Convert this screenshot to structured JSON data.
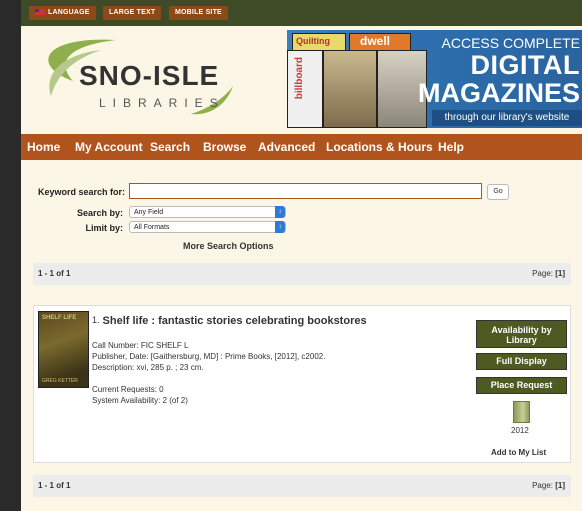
{
  "utility_bar": {
    "language": "LANGUAGE",
    "large_text": "LARGE TEXT",
    "mobile_site": "MOBILE SITE"
  },
  "logo": {
    "name": "SNO-ISLE",
    "sub": "LIBRARIES"
  },
  "banner": {
    "line1": "ACCESS COMPLETE",
    "line2": "DIGITAL",
    "line3": "MAGAZINES",
    "sub": "through our library's website",
    "mag1": "Quilting",
    "mag2": "dwell",
    "mag3": "billboard"
  },
  "nav": {
    "items": [
      "Home",
      "My Account",
      "Search",
      "Browse",
      "Advanced",
      "Locations & Hours",
      "Help"
    ]
  },
  "search": {
    "keyword_label": "Keyword search for:",
    "keyword_value": "",
    "go_label": "Go",
    "search_by_label": "Search by:",
    "search_by_value": "Any Field",
    "limit_by_label": "Limit by:",
    "limit_by_value": "All Formats",
    "more_options": "More Search Options"
  },
  "pagination": {
    "range": "1 - 1 of 1",
    "page_label": "Page:",
    "page_value": "[1]"
  },
  "result": {
    "number": "1.",
    "title": "Shelf life : fantastic stories celebrating bookstores",
    "call_number": "Call Number: FIC SHELF L",
    "publisher": "Publisher, Date: [Gaithersburg, MD] : Prime Books, [2012], c2002.",
    "description": "Description: xvi, 285 p. ; 23 cm.",
    "current_requests": "Current Requests: 0",
    "availability": "System Availability: 2 (of 2)",
    "cover_title": "SHELF LIFE",
    "cover_sub": "GREG KETTER",
    "year": "2012",
    "add_to_list": "Add to My List",
    "buttons": {
      "availability": "Availability by Library",
      "full_display": "Full Display",
      "place_request": "Place Request"
    }
  },
  "colors": {
    "nav_bg": "#b1531c",
    "utility_bg": "#3f4a26",
    "button_bg": "#4d5a22",
    "page_bg": "#fbf6e6"
  }
}
